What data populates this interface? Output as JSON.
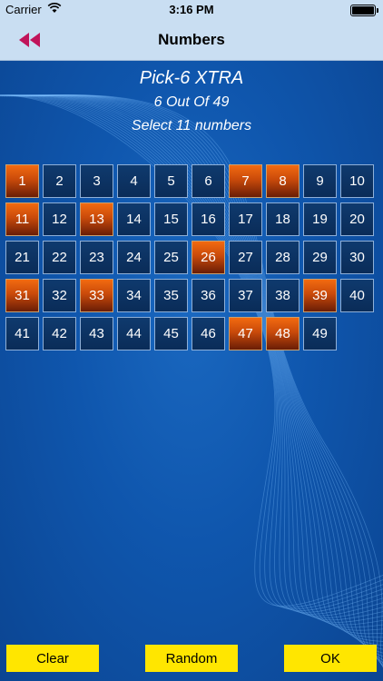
{
  "status": {
    "carrier": "Carrier",
    "time": "3:16 PM"
  },
  "nav": {
    "title": "Numbers"
  },
  "game": {
    "name": "Pick-6 XTRA",
    "odds": "6 Out Of 49",
    "instruction": "Select 11 numbers"
  },
  "numbers": [
    1,
    2,
    3,
    4,
    5,
    6,
    7,
    8,
    9,
    10,
    11,
    12,
    13,
    14,
    15,
    16,
    17,
    18,
    19,
    20,
    21,
    22,
    23,
    24,
    25,
    26,
    27,
    28,
    29,
    30,
    31,
    32,
    33,
    34,
    35,
    36,
    37,
    38,
    39,
    40,
    41,
    42,
    43,
    44,
    45,
    46,
    47,
    48,
    49
  ],
  "selected": [
    1,
    7,
    8,
    11,
    13,
    26,
    31,
    33,
    39,
    47,
    48
  ],
  "buttons": {
    "clear": "Clear",
    "random": "Random",
    "ok": "OK"
  },
  "colors": {
    "accent": "#ffe600",
    "selected": "#e05a0c",
    "back_arrow": "#c0145a"
  }
}
